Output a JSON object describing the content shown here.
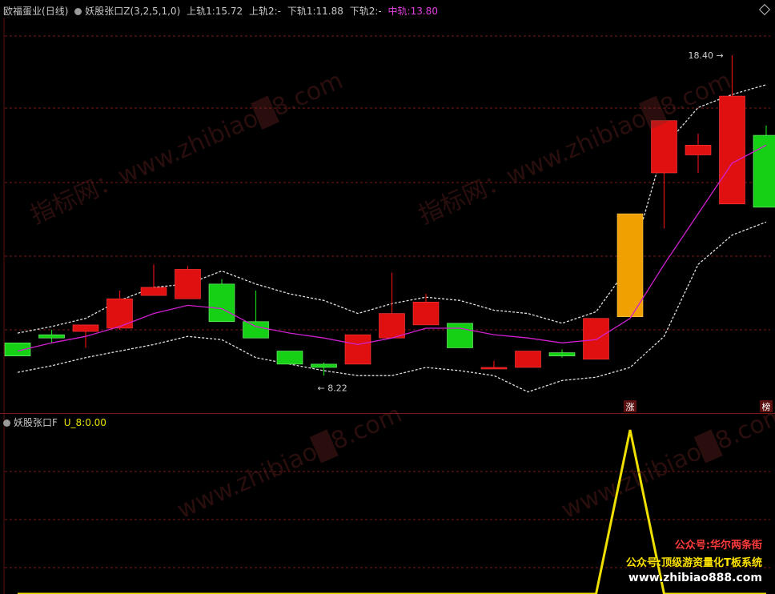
{
  "header": {
    "stock_name": "欧福蛋业",
    "period": "(日线)",
    "indicator_name": "妖股张口Z",
    "indicator_params": "(3,2,5,1,0)",
    "upper1_label": "上轨1:",
    "upper1_value": "15.72",
    "upper2_label": "上轨2:",
    "upper2_value": "-",
    "lower1_label": "下轨1:",
    "lower1_value": "11.88",
    "lower2_label": "下轨2:",
    "lower2_value": "-",
    "mid_label": "中轨:",
    "mid_value": "13.80"
  },
  "annotations": {
    "high_label": "18.40",
    "low_label": "8.22",
    "marker_zhang": "涨",
    "marker_bang": "榜"
  },
  "sub_header": {
    "indicator_name": "妖股张口F",
    "value_label": "U_8:",
    "value": "0.00"
  },
  "branding": {
    "line1": "公众号:华尔两条街",
    "line2": "公众号:顶级游资量化T板系统",
    "line3": "www.zhibiao888.com"
  },
  "watermarks": [
    "指标网：www.zhibiao█8.com",
    "www.zhibiao█8.com"
  ],
  "colors": {
    "up": "#e01010",
    "down": "#16d016",
    "special": "#f0a000",
    "mid_line": "#d020d0",
    "band": "#e0e0e0",
    "signal": "#f0e000",
    "grid": "#7a1a1a",
    "brand_red": "#ff3a3a",
    "brand_yellow": "#ffe400"
  },
  "chart_data": {
    "type": "candlestick",
    "price_range": [
      7.6,
      19.6
    ],
    "candles": [
      {
        "o": 9.6,
        "h": 9.6,
        "l": 9.2,
        "c": 9.2
      },
      {
        "o": 9.85,
        "h": 10.0,
        "l": 9.6,
        "c": 9.75
      },
      {
        "o": 9.95,
        "h": 10.05,
        "l": 9.45,
        "c": 10.15
      },
      {
        "o": 10.05,
        "h": 11.2,
        "l": 10.0,
        "c": 10.95
      },
      {
        "o": 11.05,
        "h": 12.0,
        "l": 11.05,
        "c": 11.3
      },
      {
        "o": 10.95,
        "h": 11.95,
        "l": 10.95,
        "c": 11.85
      },
      {
        "o": 11.4,
        "h": 11.55,
        "l": 10.25,
        "c": 10.25
      },
      {
        "o": 10.25,
        "h": 11.2,
        "l": 9.8,
        "c": 9.75
      },
      {
        "o": 9.35,
        "h": 9.35,
        "l": 8.95,
        "c": 8.95
      },
      {
        "o": 8.95,
        "h": 9.0,
        "l": 8.6,
        "c": 8.85
      },
      {
        "o": 8.95,
        "h": 9.85,
        "l": 8.95,
        "c": 9.85
      },
      {
        "o": 9.75,
        "h": 11.75,
        "l": 9.75,
        "c": 10.5
      },
      {
        "o": 10.15,
        "h": 11.1,
        "l": 10.15,
        "c": 10.85
      },
      {
        "o": 10.2,
        "h": 10.2,
        "l": 9.45,
        "c": 9.45
      },
      {
        "o": 8.85,
        "h": 9.05,
        "l": 8.8,
        "c": 8.85
      },
      {
        "o": 8.85,
        "h": 9.35,
        "l": 8.85,
        "c": 9.35
      },
      {
        "o": 9.3,
        "h": 9.4,
        "l": 9.15,
        "c": 9.2
      },
      {
        "o": 9.1,
        "h": 10.35,
        "l": 9.1,
        "c": 10.35
      },
      {
        "o": 10.4,
        "h": 13.55,
        "l": 10.4,
        "c": 13.55
      },
      {
        "o": 14.8,
        "h": 16.4,
        "l": 13.1,
        "c": 16.4
      },
      {
        "o": 15.35,
        "h": 16.0,
        "l": 14.8,
        "c": 15.65
      },
      {
        "o": 13.85,
        "h": 18.4,
        "l": 13.85,
        "c": 17.15
      },
      {
        "o": 15.95,
        "h": 16.25,
        "l": 13.75,
        "c": 13.75
      }
    ],
    "special_candle_index": 18,
    "mid_line": [
      9.35,
      9.6,
      9.8,
      10.1,
      10.5,
      10.75,
      10.65,
      10.1,
      9.9,
      9.75,
      9.55,
      9.75,
      10.05,
      10.05,
      9.85,
      9.75,
      9.6,
      9.7,
      10.35,
      12.0,
      13.55,
      15.1,
      15.65
    ],
    "upper_band": [
      9.9,
      10.1,
      10.35,
      10.9,
      11.3,
      11.4,
      11.8,
      11.4,
      11.1,
      10.9,
      10.5,
      10.8,
      11.0,
      10.9,
      10.6,
      10.5,
      10.2,
      10.55,
      12.0,
      15.6,
      16.8,
      17.2,
      17.5
    ],
    "lower_band": [
      8.7,
      8.9,
      9.15,
      9.35,
      9.55,
      9.8,
      9.7,
      9.15,
      8.95,
      8.75,
      8.6,
      8.6,
      8.85,
      8.75,
      8.6,
      8.1,
      8.45,
      8.55,
      8.85,
      9.8,
      12.0,
      12.9,
      13.3
    ],
    "signal": [
      0,
      0,
      0,
      0,
      0,
      0,
      0,
      0,
      0,
      0,
      0,
      0,
      0,
      0,
      0,
      0,
      0,
      0,
      1,
      0,
      0,
      0,
      0
    ],
    "signal_range": [
      0,
      1
    ]
  }
}
